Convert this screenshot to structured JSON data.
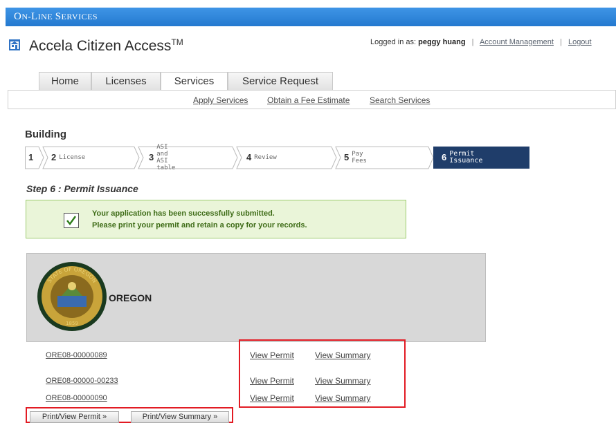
{
  "header": {
    "banner": "On-Line Services",
    "banner_first": "O",
    "banner_rest1": "N-",
    "banner_l": "L",
    "banner_rest2": "INE ",
    "banner_s": "S",
    "banner_rest3": "ERVICES"
  },
  "app": {
    "title": "Accela Citizen Access",
    "tm": "TM"
  },
  "login": {
    "prefix": "Logged in as:",
    "user": "peggy huang",
    "account_link": "Account Management",
    "logout_link": "Logout"
  },
  "tabs": [
    {
      "label": "Home"
    },
    {
      "label": "Licenses"
    },
    {
      "label": "Services"
    },
    {
      "label": "Service Request"
    }
  ],
  "subnav": [
    {
      "label": "Apply Services"
    },
    {
      "label": "Obtain a Fee Estimate"
    },
    {
      "label": "Search Services"
    }
  ],
  "section": {
    "title": "Building"
  },
  "steps": [
    {
      "num": "1",
      "label": ""
    },
    {
      "num": "2",
      "label": "License"
    },
    {
      "num": "3",
      "label_line1": "ASI and ASI",
      "label_line2": "table"
    },
    {
      "num": "4",
      "label": "Review"
    },
    {
      "num": "5",
      "label": "Pay Fees"
    },
    {
      "num": "6",
      "label_line1": "Permit",
      "label_line2": "Issuance"
    }
  ],
  "step_title": "Step 6 : Permit Issuance",
  "message": {
    "line1": "Your application has been successfully submitted.",
    "line2": "Please print your permit and retain a copy for your records."
  },
  "agency": {
    "name": "OREGON",
    "seal_top": "STATE OF OREGON",
    "seal_year": "1859"
  },
  "records": [
    {
      "id": "ORE08-00000089",
      "view_permit": "View Permit",
      "view_summary": "View Summary"
    },
    {
      "id": "ORE08-00000-00233",
      "view_permit": "View Permit",
      "view_summary": "View Summary"
    },
    {
      "id": "ORE08-00000090",
      "view_permit": "View Permit",
      "view_summary": "View Summary"
    }
  ],
  "buttons": {
    "print_permit": "Print/View Permit »",
    "print_summary": "Print/View Summary »"
  },
  "colors": {
    "banner": "#2479cf",
    "active_step": "#1f3d6a",
    "highlight": "#e21b23",
    "success_bg": "#eaf5d9"
  }
}
